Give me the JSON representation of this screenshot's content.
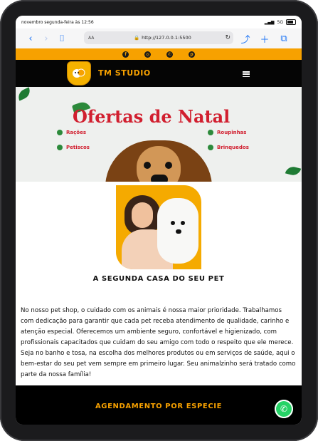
{
  "status_bar": {
    "datetime": "novembro segunda-feira às 12:56",
    "signal": "5G"
  },
  "browser": {
    "text_size_label": "AA",
    "url": "http://127.0.0.1:5500"
  },
  "site": {
    "brand": "TM STUDIO",
    "social_icons": [
      "facebook-icon",
      "instagram-icon",
      "whatsapp-icon",
      "pinterest-icon"
    ],
    "hero": {
      "title": "Ofertas de Natal",
      "categories_left": [
        "Rações",
        "Petiscos"
      ],
      "categories_right": [
        "Roupinhas",
        "Brinquedos"
      ]
    },
    "section_title": "A SEGUNDA CASA DO SEU PET",
    "description": "No nosso pet shop, o cuidado com os animais é nossa maior prioridade. Trabalhamos com dedicação para garantir que cada pet receba atendimento de qualidade, carinho e atenção especial. Oferecemos um ambiente seguro, confortável e higienizado, com profissionais capacitados que cuidam do seu amigo com todo o respeito que ele merece. Seja no banho e tosa, na escolha dos melhores produtos ou em serviços de saúde, aqui o bem-estar do seu pet vem sempre em primeiro lugar. Seu animalzinho será tratado como parte da nossa família!",
    "footer_title": "AGENDAMENTO POR ESPECIE"
  },
  "colors": {
    "accent": "#f7a100",
    "red": "#d11f2f",
    "green": "#2c8a3b",
    "whatsapp": "#25d366"
  }
}
